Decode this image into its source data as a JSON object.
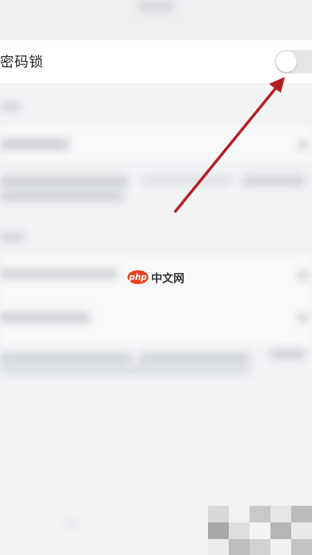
{
  "setting_row": {
    "label": "密码锁",
    "toggle_on": false
  },
  "watermark": {
    "logo": "php",
    "text": "中文网"
  },
  "colors": {
    "arrow": "#b32025",
    "toggle_off": "#e4e5e7",
    "page_bg": "#f2f3f5"
  },
  "icons": [
    "arrow-annotation-icon",
    "php-logo-icon"
  ]
}
